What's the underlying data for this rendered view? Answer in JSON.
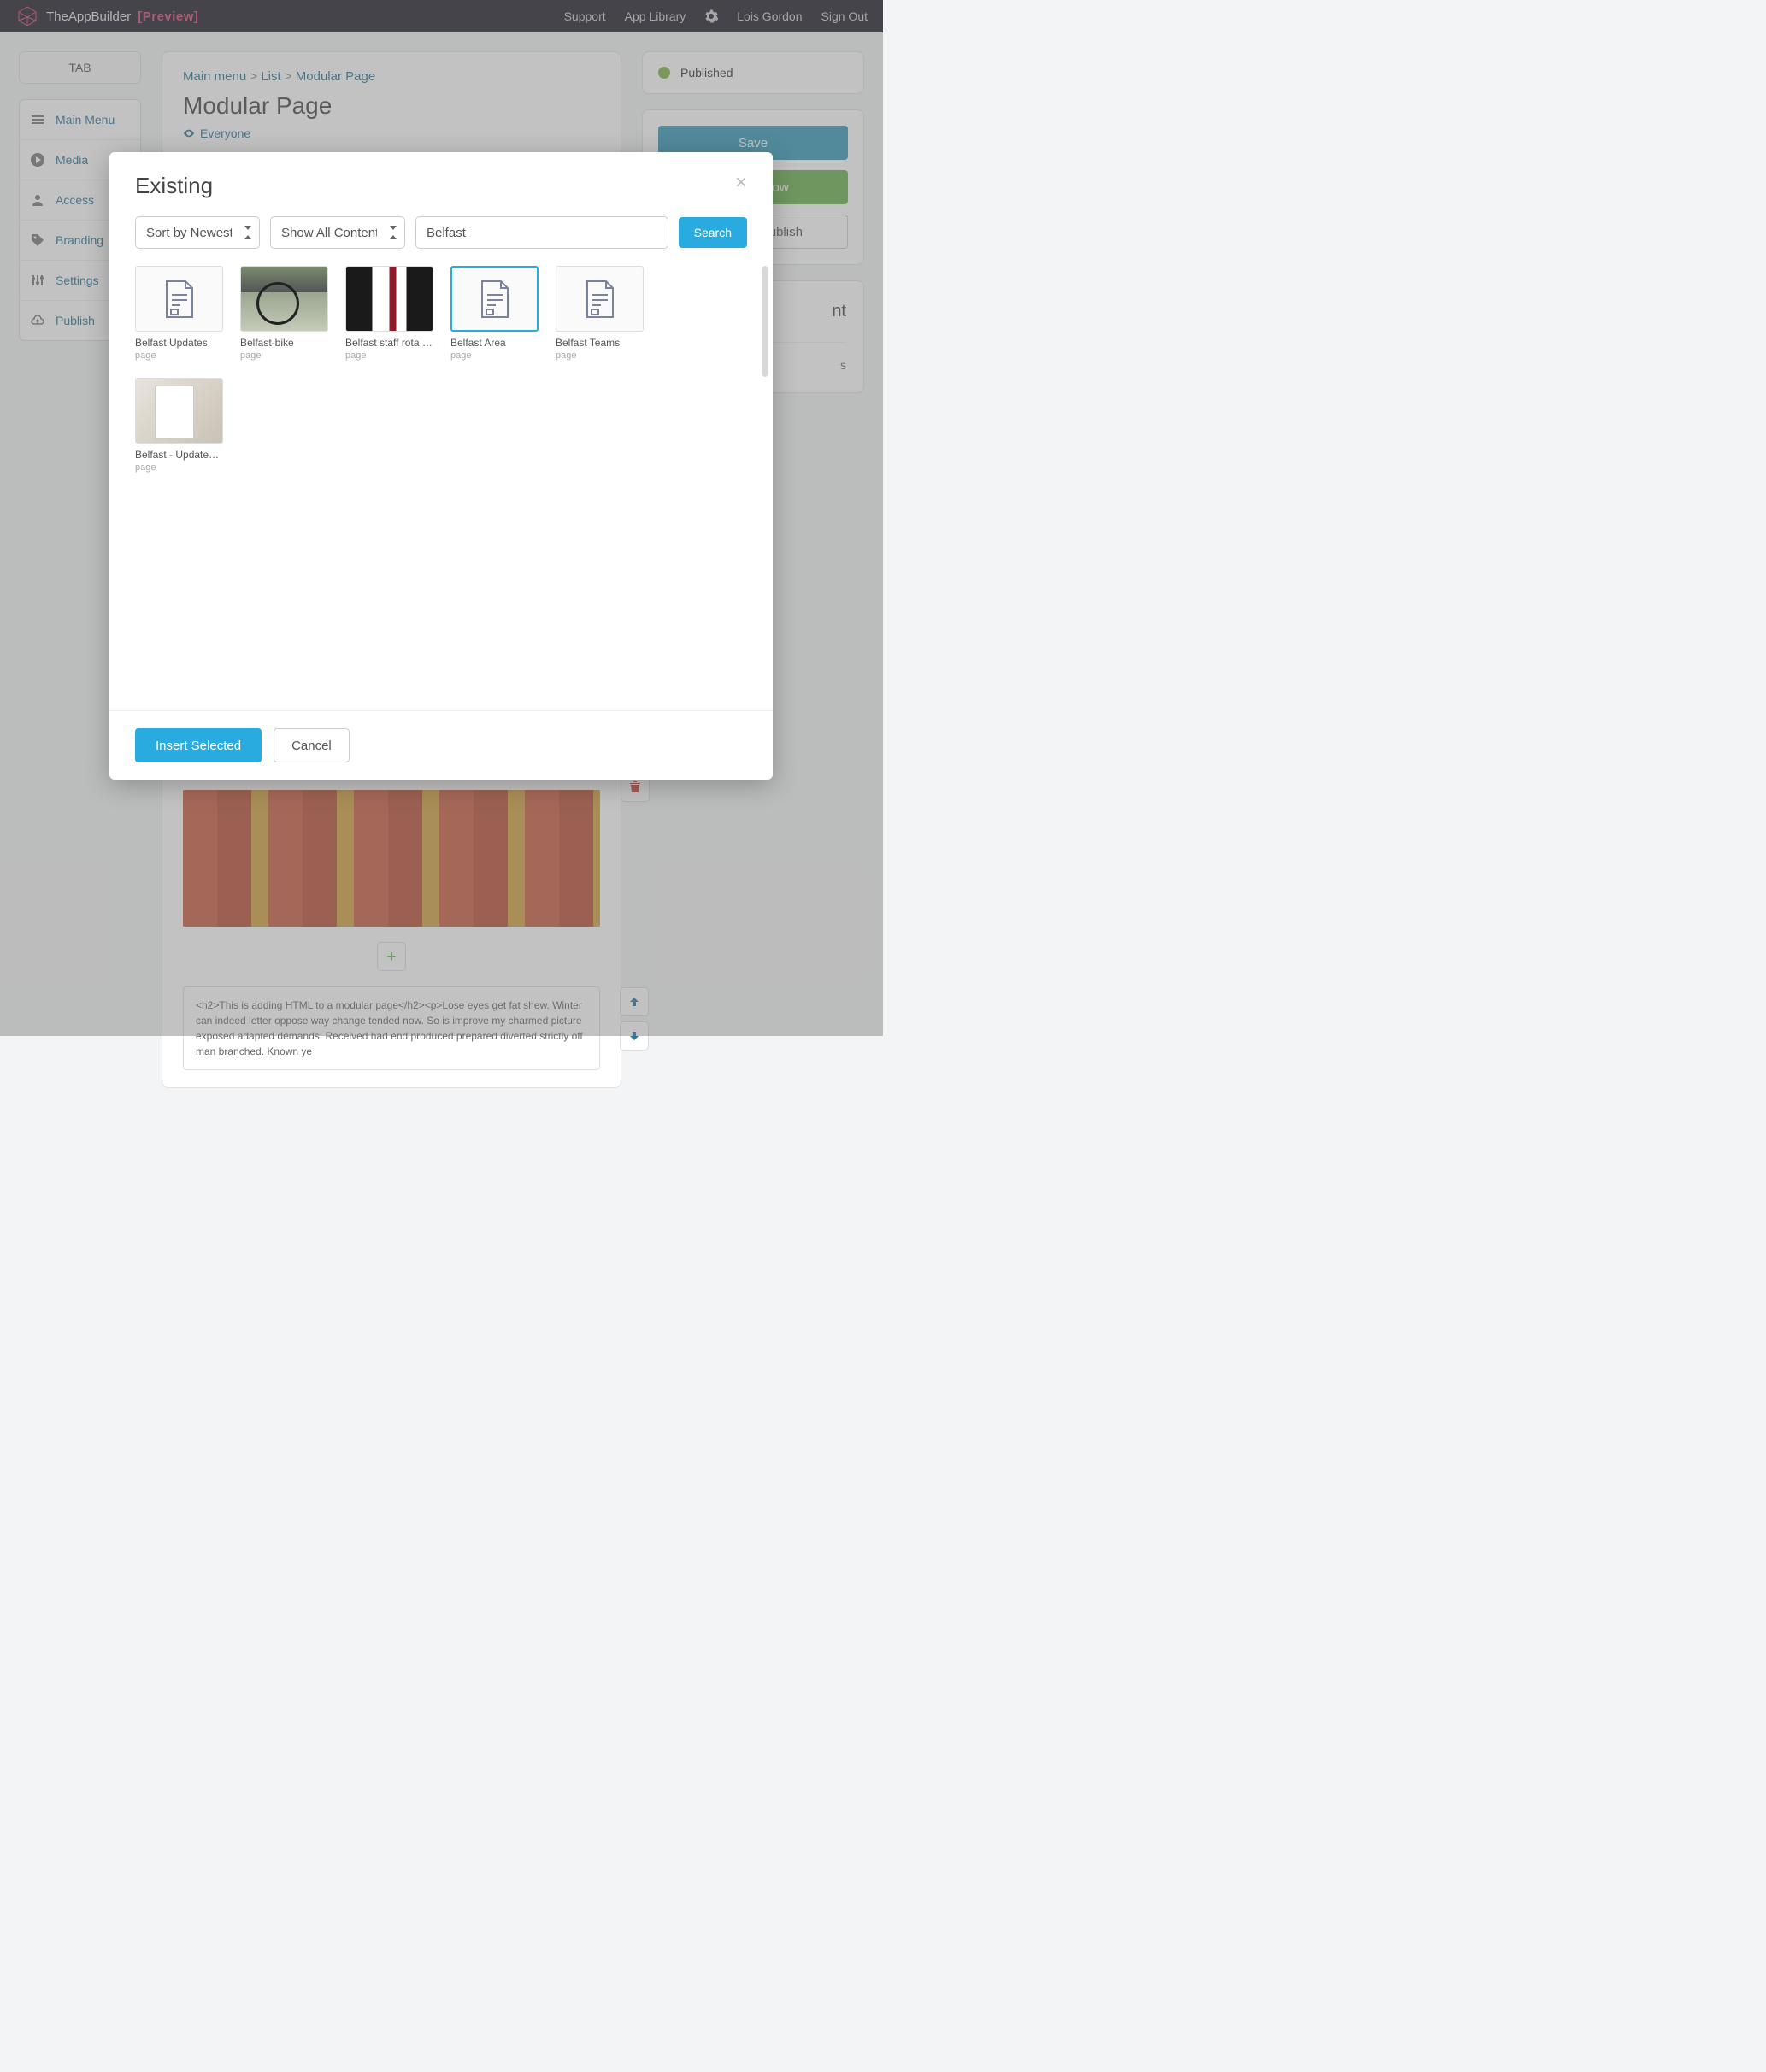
{
  "header": {
    "brand_name": "TheAppBuilder",
    "brand_suffix": "[Preview]",
    "nav": {
      "support": "Support",
      "library": "App Library",
      "user": "Lois Gordon",
      "signout": "Sign Out"
    }
  },
  "sidebar": {
    "tab_button": "TAB",
    "items": [
      {
        "label": "Main Menu",
        "icon": "menu-icon"
      },
      {
        "label": "Media",
        "icon": "play-icon"
      },
      {
        "label": "Access",
        "icon": "person-icon"
      },
      {
        "label": "Branding",
        "icon": "tag-icon"
      },
      {
        "label": "Settings",
        "icon": "sliders-icon"
      },
      {
        "label": "Publish",
        "icon": "cloud-icon"
      }
    ]
  },
  "breadcrumb": {
    "root": "Main menu",
    "mid": "List",
    "leaf": "Modular Page"
  },
  "page": {
    "title": "Modular Page",
    "visibility": "Everyone",
    "html_snippet": "<h2>This is adding HTML to a modular page</h2><p>Lose eyes get fat shew. Winter can indeed letter oppose way change tended now. So is improve my charmed picture exposed adapted demands. Received had end produced prepared diverted strictly off man branched. Known ye"
  },
  "status": {
    "label": "Published",
    "color": "#7cb342"
  },
  "actions": {
    "save": "Save",
    "publish_now": "Publish Now",
    "schedule": "Schedule Publish"
  },
  "right_extra": {
    "title_fragment": "nt",
    "sub_fragment": "s"
  },
  "modal": {
    "title": "Existing",
    "sort_label": "Sort by Newest",
    "filter_label": "Show All Content",
    "search_value": "Belfast",
    "search_button": "Search",
    "insert_button": "Insert Selected",
    "cancel_button": "Cancel",
    "results": [
      {
        "title": "Belfast Updates",
        "type": "page",
        "thumb": "doc",
        "selected": false
      },
      {
        "title": "Belfast-bike",
        "type": "page",
        "thumb": "bike",
        "selected": false
      },
      {
        "title": "Belfast staff rota ar…",
        "type": "page",
        "thumb": "suit",
        "selected": false
      },
      {
        "title": "Belfast Area",
        "type": "page",
        "thumb": "doc",
        "selected": true
      },
      {
        "title": "Belfast Teams",
        "type": "page",
        "thumb": "doc",
        "selected": false
      },
      {
        "title": "Belfast - Updates t…",
        "type": "page",
        "thumb": "contract",
        "selected": false
      }
    ]
  }
}
